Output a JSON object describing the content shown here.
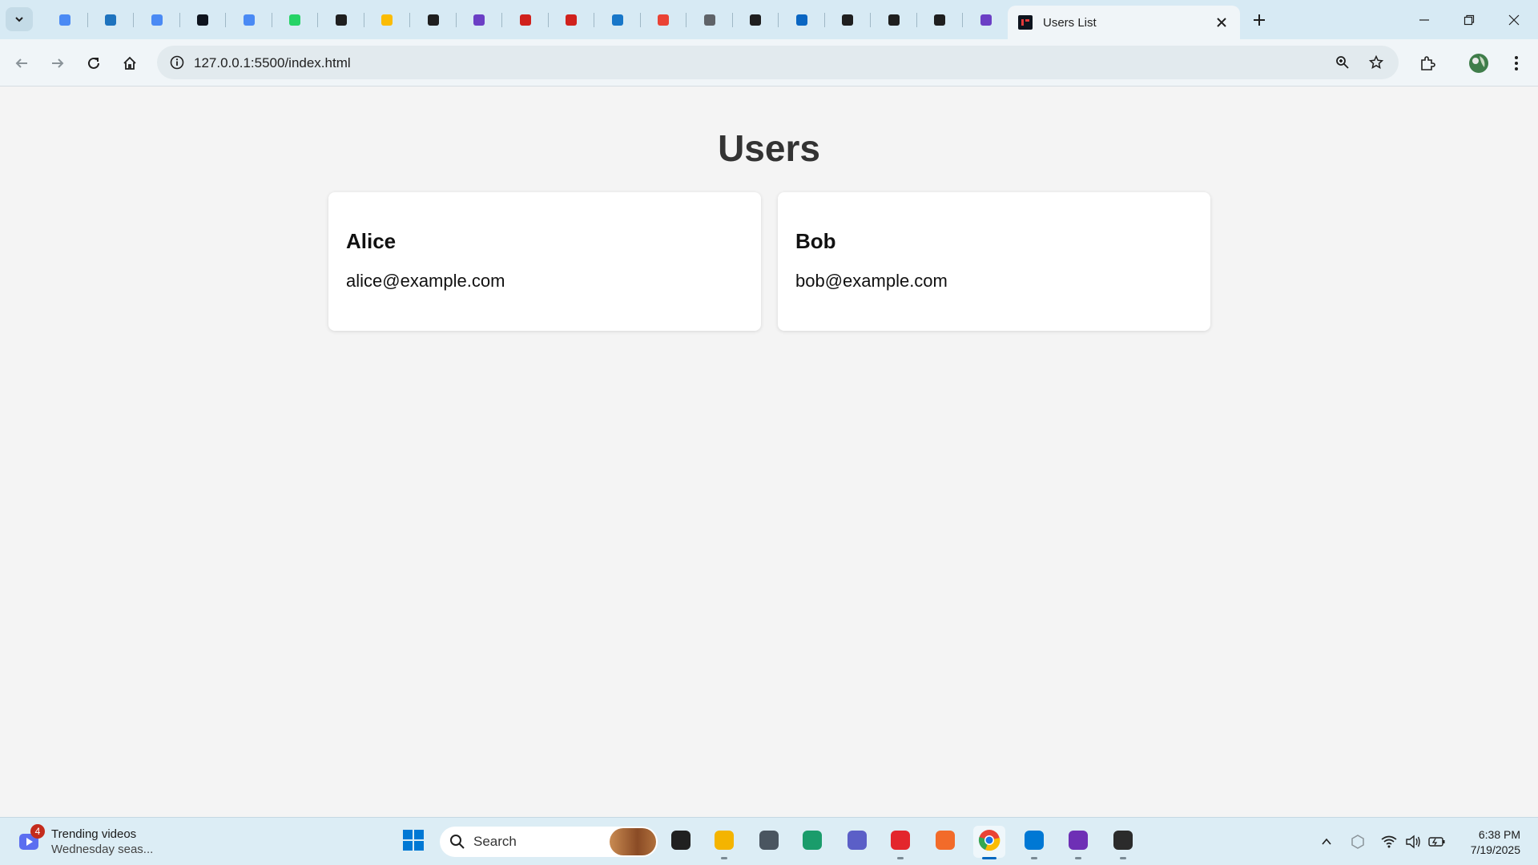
{
  "browser": {
    "pinned_tabs": [
      {
        "icon": "gemini-icon",
        "color": "#4a8af4"
      },
      {
        "icon": "site-favicon",
        "color": "#1e73be"
      },
      {
        "icon": "gemini-icon",
        "color": "#4a8af4"
      },
      {
        "icon": "hackerrank-icon",
        "color": "#0e141e"
      },
      {
        "icon": "gemini-icon",
        "color": "#4a8af4"
      },
      {
        "icon": "whatsapp-icon",
        "color": "#25d366"
      },
      {
        "icon": "chatgpt-icon",
        "color": "#1f1f1f"
      },
      {
        "icon": "google-drive-icon",
        "color": "#fbbc04"
      },
      {
        "icon": "chatgpt-icon",
        "color": "#1f1f1f"
      },
      {
        "icon": "notes-icon",
        "color": "#6b3fc5"
      },
      {
        "icon": "tech-red-icon",
        "color": "#d0211c"
      },
      {
        "icon": "tech-red-icon",
        "color": "#d0211c"
      },
      {
        "icon": "k-icon",
        "color": "#1877c9"
      },
      {
        "icon": "gmail-icon",
        "color": "#ea4335"
      },
      {
        "icon": "globe-icon",
        "color": "#5f6368"
      },
      {
        "icon": "chatgpt-icon",
        "color": "#1f1f1f"
      },
      {
        "icon": "linkedin-icon",
        "color": "#0a66c2"
      },
      {
        "icon": "github-icon",
        "color": "#1f1f1f"
      },
      {
        "icon": "chatgpt-icon",
        "color": "#1f1f1f"
      },
      {
        "icon": "chatgpt-icon",
        "color": "#1f1f1f"
      },
      {
        "icon": "notes-icon",
        "color": "#6b3fc5"
      }
    ],
    "active_tab": {
      "title": "Users List",
      "icon": "hackerrank-icon"
    },
    "url": "127.0.0.1:5500/index.html"
  },
  "page": {
    "heading": "Users",
    "users": [
      {
        "name": "Alice",
        "email": "alice@example.com"
      },
      {
        "name": "Bob",
        "email": "bob@example.com"
      }
    ]
  },
  "taskbar": {
    "widget": {
      "badge": "4",
      "title": "Trending videos",
      "subtitle": "Wednesday seas..."
    },
    "search_label": "Search",
    "apps": [
      {
        "icon": "windows-start-icon",
        "color": "#0078d4"
      },
      {
        "icon": "task-view-icon",
        "color": "#202020"
      },
      {
        "icon": "file-explorer-icon",
        "color": "#f4b400"
      },
      {
        "icon": "camera-icon",
        "color": "#4a5560"
      },
      {
        "icon": "edge-icon",
        "color": "#1a9c6b"
      },
      {
        "icon": "teams-icon",
        "color": "#5b5fc7"
      },
      {
        "icon": "wps-office-icon",
        "color": "#e3262c"
      },
      {
        "icon": "pen-app-icon",
        "color": "#f26b2a"
      },
      {
        "icon": "chrome-icon",
        "color": "#1a73e8"
      },
      {
        "icon": "vscode-icon",
        "color": "#0078d4"
      },
      {
        "icon": "github-desktop-icon",
        "color": "#6e2fb5"
      },
      {
        "icon": "terminal-icon",
        "color": "#2b2b2b"
      }
    ],
    "time": "6:38 PM",
    "date": "7/19/2025"
  }
}
